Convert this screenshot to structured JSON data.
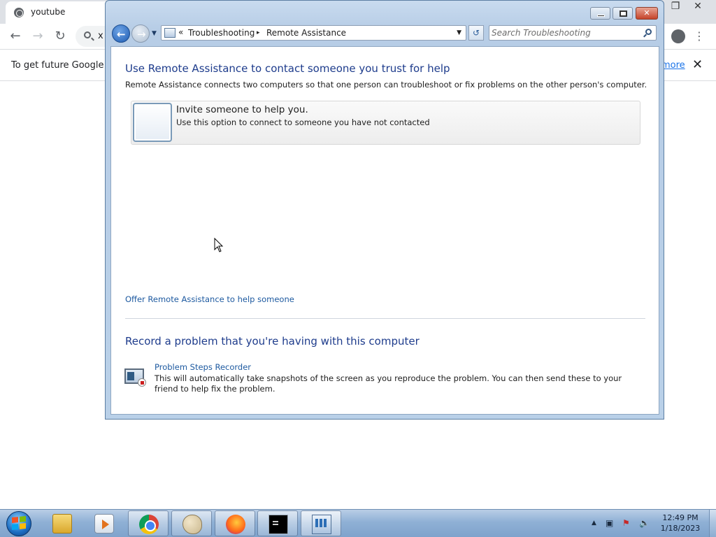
{
  "chrome": {
    "tab_title": "youtube",
    "omnibox_value": "x",
    "infobar_message": "To get future Google Ch",
    "infobar_link": "more",
    "infobar_close": "✕",
    "win_restore": "❐",
    "win_close": "✕"
  },
  "window": {
    "nav": {
      "back": "←",
      "forward": "→",
      "dropdown": "▼"
    },
    "address": {
      "prefix": "«",
      "crumbs": [
        "Troubleshooting",
        "Remote Assistance"
      ],
      "separator": "▸",
      "dropdown": "▼"
    },
    "refresh": "↺",
    "search": {
      "placeholder": "Search Troubleshooting"
    },
    "controls": {
      "close": "✕"
    }
  },
  "main": {
    "remote_heading": "Use Remote Assistance to contact someone you trust for help",
    "remote_desc": "Remote Assistance connects two computers so that one person can troubleshoot or fix problems on the other person's computer.",
    "invite": {
      "title": "Invite someone to help you.",
      "subtitle": "Use this option to connect to someone you have not contacted"
    },
    "offer_link": "Offer Remote Assistance to help someone",
    "record_heading": "Record a problem that you're having with this computer",
    "psr": {
      "title": "Problem Steps Recorder",
      "desc": "This will automatically take snapshots of the screen as you reproduce the problem. You can then send these to your friend to help fix the problem."
    }
  },
  "taskbar": {
    "apps": [
      "windows-explorer",
      "media-player",
      "google-chrome",
      "paint",
      "firefox",
      "command-prompt",
      "control-panel"
    ],
    "active_app": "control-panel",
    "tray": {
      "show_hidden": "▲"
    },
    "clock": {
      "time": "12:49 PM",
      "date": "1/18/2023"
    }
  },
  "colors": {
    "heading_blue": "#1e3c8c",
    "link_blue": "#1e5aa0",
    "chrome_link": "#1a73e8",
    "taskbar": "#8fb0d5"
  }
}
